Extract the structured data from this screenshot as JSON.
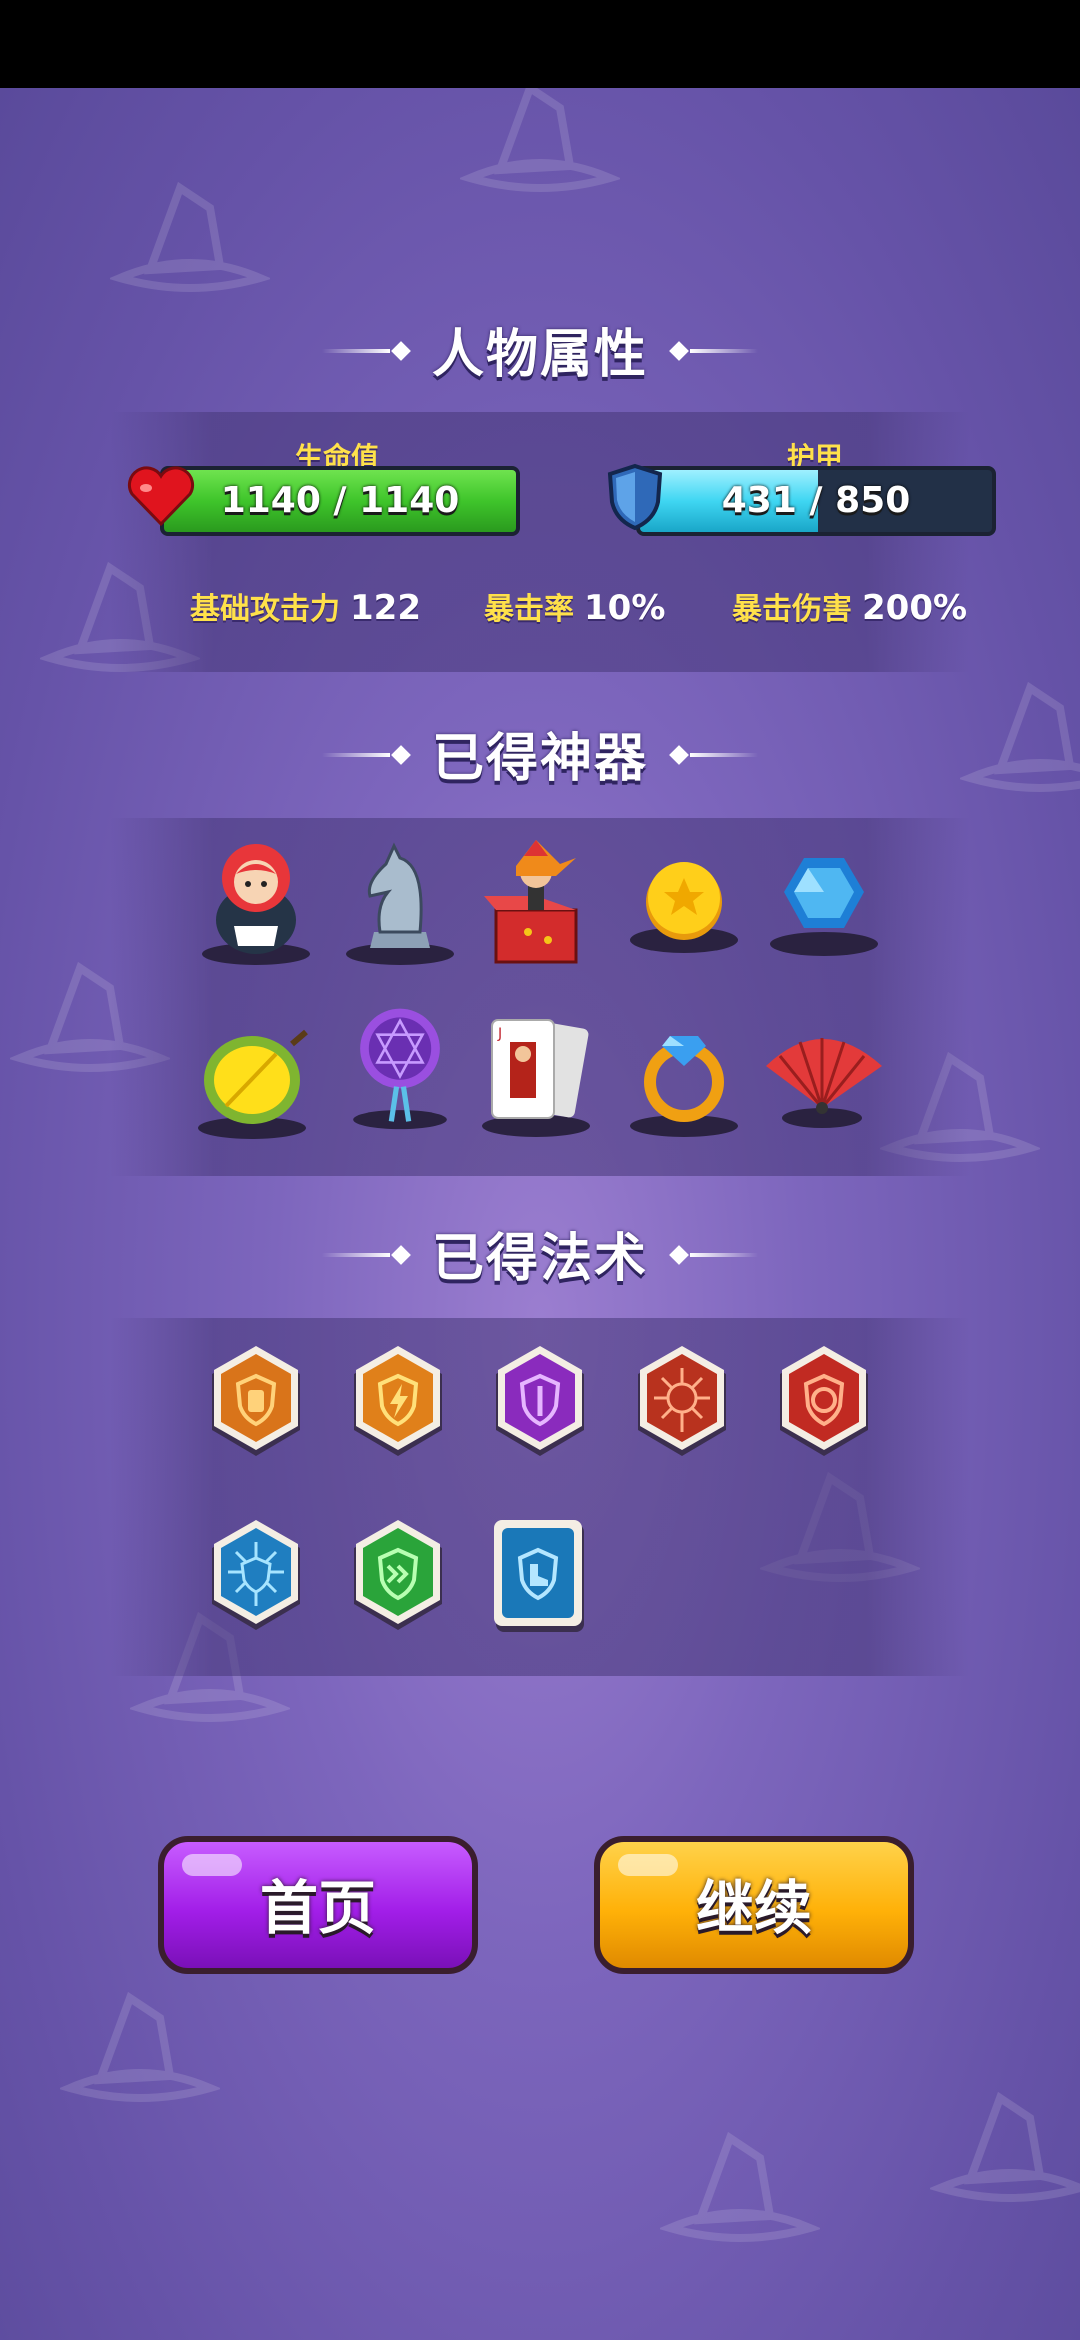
{
  "sections": {
    "attributes_title": "人物属性",
    "artifacts_title": "已得神器",
    "spells_title": "已得法术"
  },
  "health": {
    "label": "生命值",
    "current": 1140,
    "max": 1140,
    "text": "1140 / 1140",
    "fraction": 1.0,
    "color": "#3fc52b"
  },
  "armor": {
    "label": "护甲",
    "current": 431,
    "max": 850,
    "text": "431 / 850",
    "fraction": 0.507,
    "color": "#3fd6f2"
  },
  "stats": {
    "attack_label": "基础攻击力",
    "attack_value": "122",
    "crit_rate_label": "暴击率",
    "crit_rate_value": "10%",
    "crit_damage_label": "暴击伤害",
    "crit_damage_value": "200%"
  },
  "artifacts": [
    {
      "name": "matryoshka-doll-icon"
    },
    {
      "name": "chess-knight-icon"
    },
    {
      "name": "jack-in-the-box-icon"
    },
    {
      "name": "gold-coin-icon"
    },
    {
      "name": "blue-gem-icon"
    },
    {
      "name": "durian-icon"
    },
    {
      "name": "dreamcatcher-icon"
    },
    {
      "name": "playing-card-icon"
    },
    {
      "name": "diamond-ring-icon"
    },
    {
      "name": "folding-fan-icon"
    }
  ],
  "spells": [
    {
      "name": "shield-potion-spell-icon",
      "color": "#d9741a"
    },
    {
      "name": "lightning-shield-spell-icon",
      "color": "#e0801a"
    },
    {
      "name": "purple-shield-spell-icon",
      "color": "#8a2bbd"
    },
    {
      "name": "fire-burst-spell-icon",
      "color": "#b8321e"
    },
    {
      "name": "fire-ring-spell-icon",
      "color": "#c12a22"
    },
    {
      "name": "ice-shield-spell-icon",
      "color": "#1f7ec0"
    },
    {
      "name": "speed-shield-spell-icon",
      "color": "#2aa43a"
    },
    {
      "name": "boot-shield-spell-icon",
      "color": "#1a78b8"
    }
  ],
  "buttons": {
    "home_label": "首页",
    "home_color": "#a21ee8",
    "continue_label": "继续",
    "continue_color": "#ffb108"
  }
}
